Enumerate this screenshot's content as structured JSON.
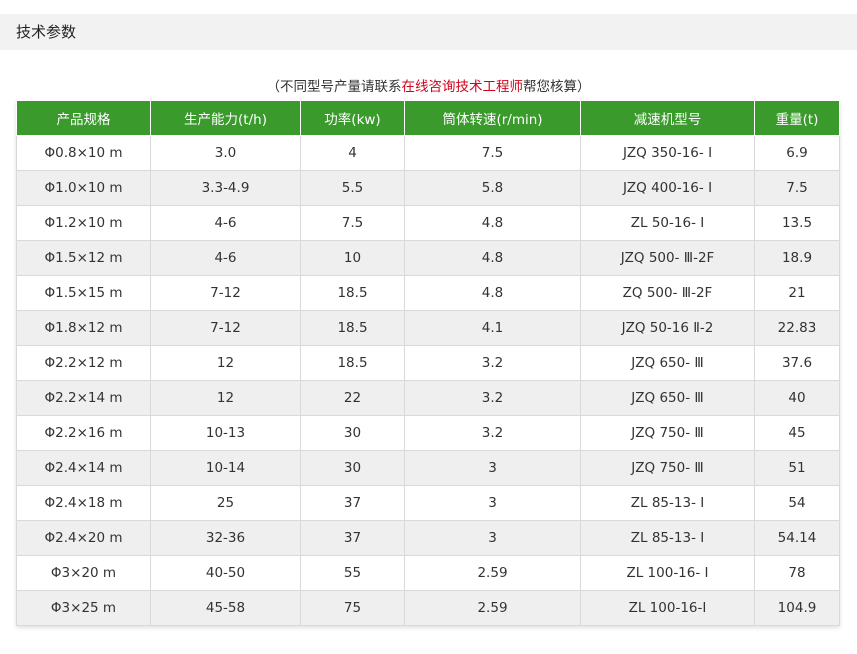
{
  "section": {
    "title": "技术参数"
  },
  "note": {
    "prefix": "（不同型号产量请联系",
    "link": "在线咨询技术工程师",
    "suffix": "帮您核算）"
  },
  "colors": {
    "header_bg": "#3a9a2c",
    "stripe": "#efefef",
    "link": "#d0021b"
  },
  "table": {
    "columns": [
      "产品规格",
      "生产能力(t/h)",
      "功率(kw)",
      "筒体转速(r/min)",
      "减速机型号",
      "重量(t)"
    ],
    "rows": [
      [
        "Φ0.8×10 m",
        "3.0",
        "4",
        "7.5",
        "JZQ 350-16- Ⅰ",
        "6.9"
      ],
      [
        "Φ1.0×10 m",
        "3.3-4.9",
        "5.5",
        "5.8",
        "JZQ 400-16- Ⅰ",
        "7.5"
      ],
      [
        "Φ1.2×10 m",
        "4-6",
        "7.5",
        "4.8",
        "ZL 50-16- Ⅰ",
        "13.5"
      ],
      [
        "Φ1.5×12 m",
        "4-6",
        "10",
        "4.8",
        "JZQ 500- Ⅲ-2F",
        "18.9"
      ],
      [
        "Φ1.5×15 m",
        "7-12",
        "18.5",
        "4.8",
        "ZQ 500- Ⅲ-2F",
        "21"
      ],
      [
        "Φ1.8×12 m",
        "7-12",
        "18.5",
        "4.1",
        "JZQ 50-16 Ⅱ-2",
        "22.83"
      ],
      [
        "Φ2.2×12 m",
        "12",
        "18.5",
        "3.2",
        "JZQ 650- Ⅲ",
        "37.6"
      ],
      [
        "Φ2.2×14 m",
        "12",
        "22",
        "3.2",
        "JZQ 650- Ⅲ",
        "40"
      ],
      [
        "Φ2.2×16 m",
        "10-13",
        "30",
        "3.2",
        "JZQ 750- Ⅲ",
        "45"
      ],
      [
        "Φ2.4×14 m",
        "10-14",
        "30",
        "3",
        "JZQ 750- Ⅲ",
        "51"
      ],
      [
        "Φ2.4×18 m",
        "25",
        "37",
        "3",
        "ZL 85-13- Ⅰ",
        "54"
      ],
      [
        "Φ2.4×20 m",
        "32-36",
        "37",
        "3",
        "ZL 85-13- Ⅰ",
        "54.14"
      ],
      [
        "Φ3×20 m",
        "40-50",
        "55",
        "2.59",
        "ZL 100-16- Ⅰ",
        "78"
      ],
      [
        "Φ3×25 m",
        "45-58",
        "75",
        "2.59",
        "ZL 100-16-I",
        "104.9"
      ]
    ]
  }
}
